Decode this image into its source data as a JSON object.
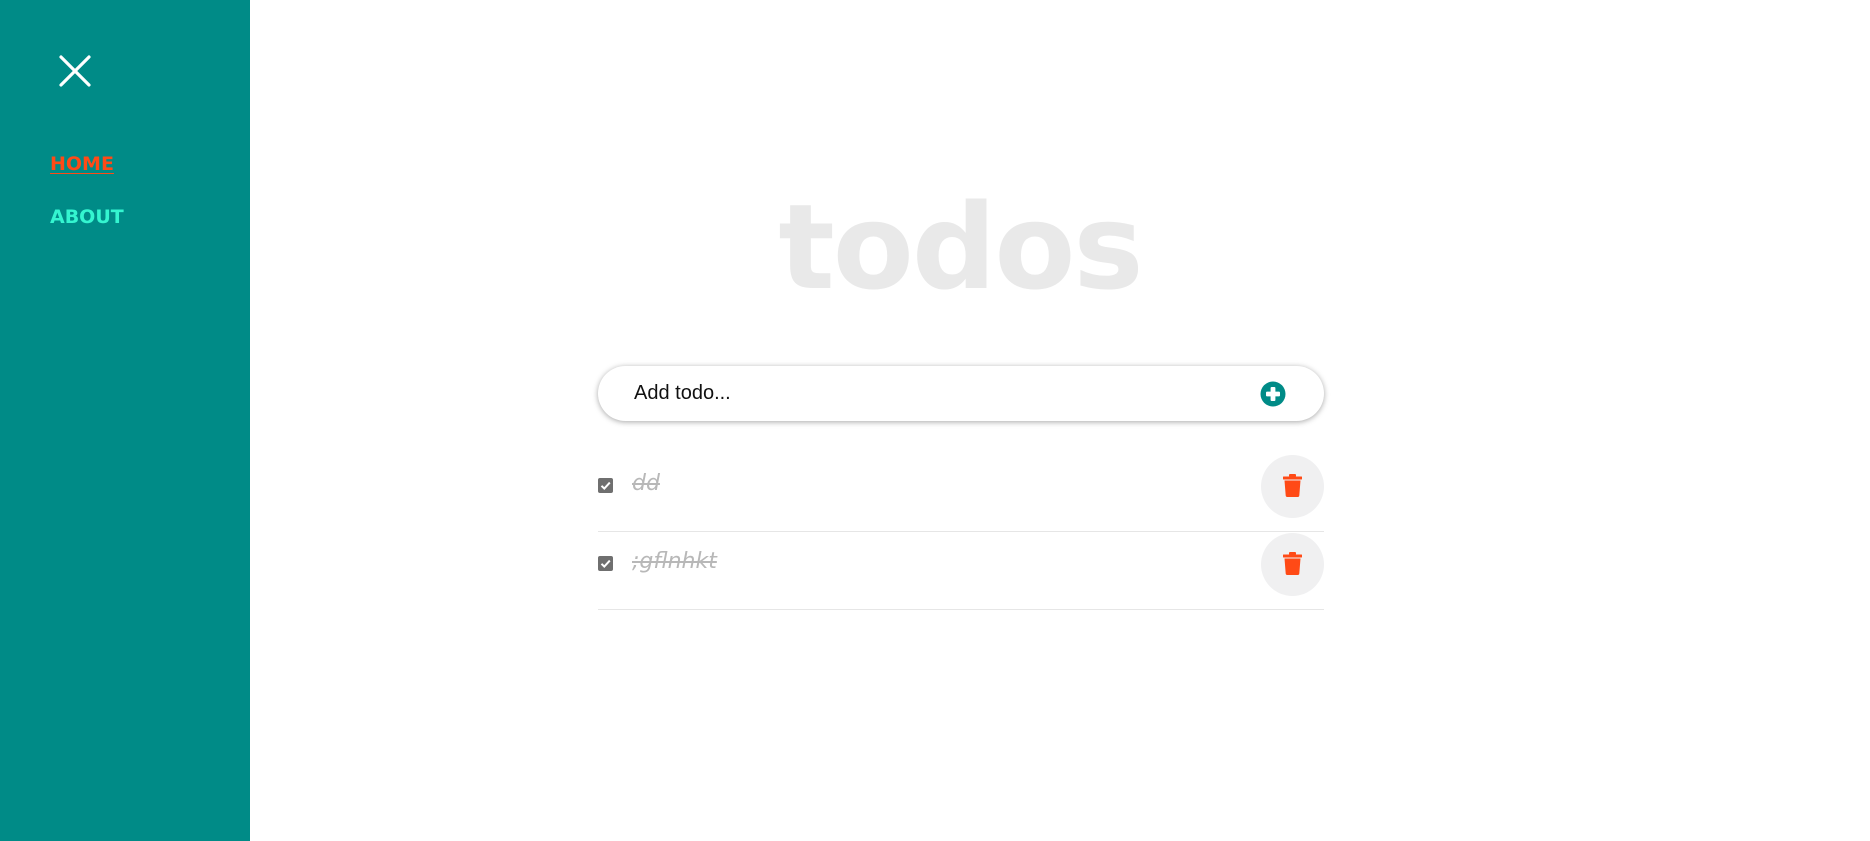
{
  "sidebar": {
    "bg_color": "#008b87",
    "close_icon": "close-icon",
    "nav": [
      {
        "label": "HOME",
        "active": true,
        "color": "#ff4a16"
      },
      {
        "label": "ABOUT",
        "active": false,
        "color": "#34f5d0"
      }
    ]
  },
  "main": {
    "title": "todos",
    "add_input": {
      "placeholder": "Add todo...",
      "value": "",
      "add_icon": "plus-circle-icon",
      "accent_color": "#008b87"
    },
    "todos": [
      {
        "text": "dd",
        "completed": true,
        "delete_icon": "trash-icon"
      },
      {
        "text": ";gflnhkt",
        "completed": true,
        "delete_icon": "trash-icon"
      }
    ],
    "delete_color": "#ff4a16"
  }
}
